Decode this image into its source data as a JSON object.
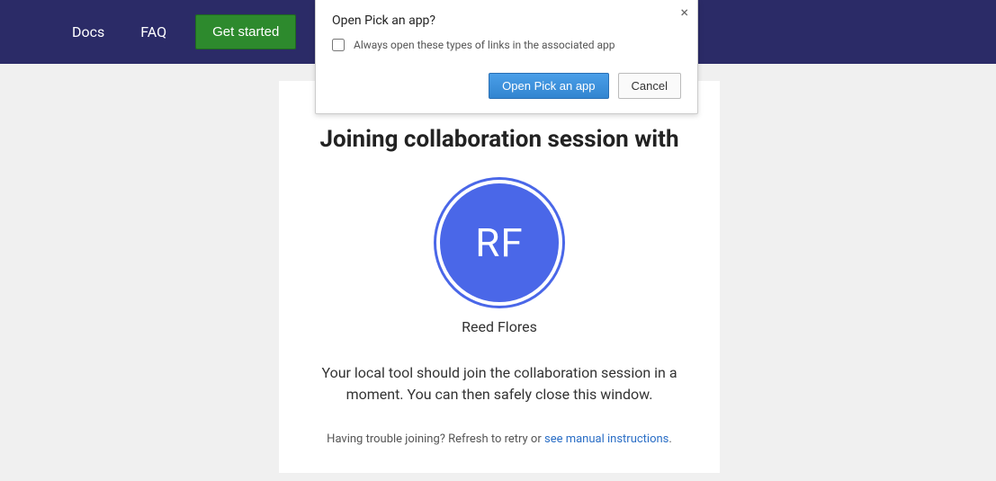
{
  "nav": {
    "docs": "Docs",
    "faq": "FAQ",
    "get_started": "Get started"
  },
  "dialog": {
    "title": "Open Pick an app?",
    "checkbox_label": "Always open these types of links in the associated app",
    "open_button": "Open Pick an app",
    "cancel_button": "Cancel"
  },
  "session": {
    "heading": "Joining collaboration session with",
    "user_initials": "RF",
    "user_name": "Reed Flores",
    "description": "Your local tool should join the collaboration session in a moment. You can then safely close this window.",
    "trouble_prefix": "Having trouble joining? Refresh to retry or ",
    "trouble_link": "see manual instructions",
    "trouble_suffix": "."
  }
}
